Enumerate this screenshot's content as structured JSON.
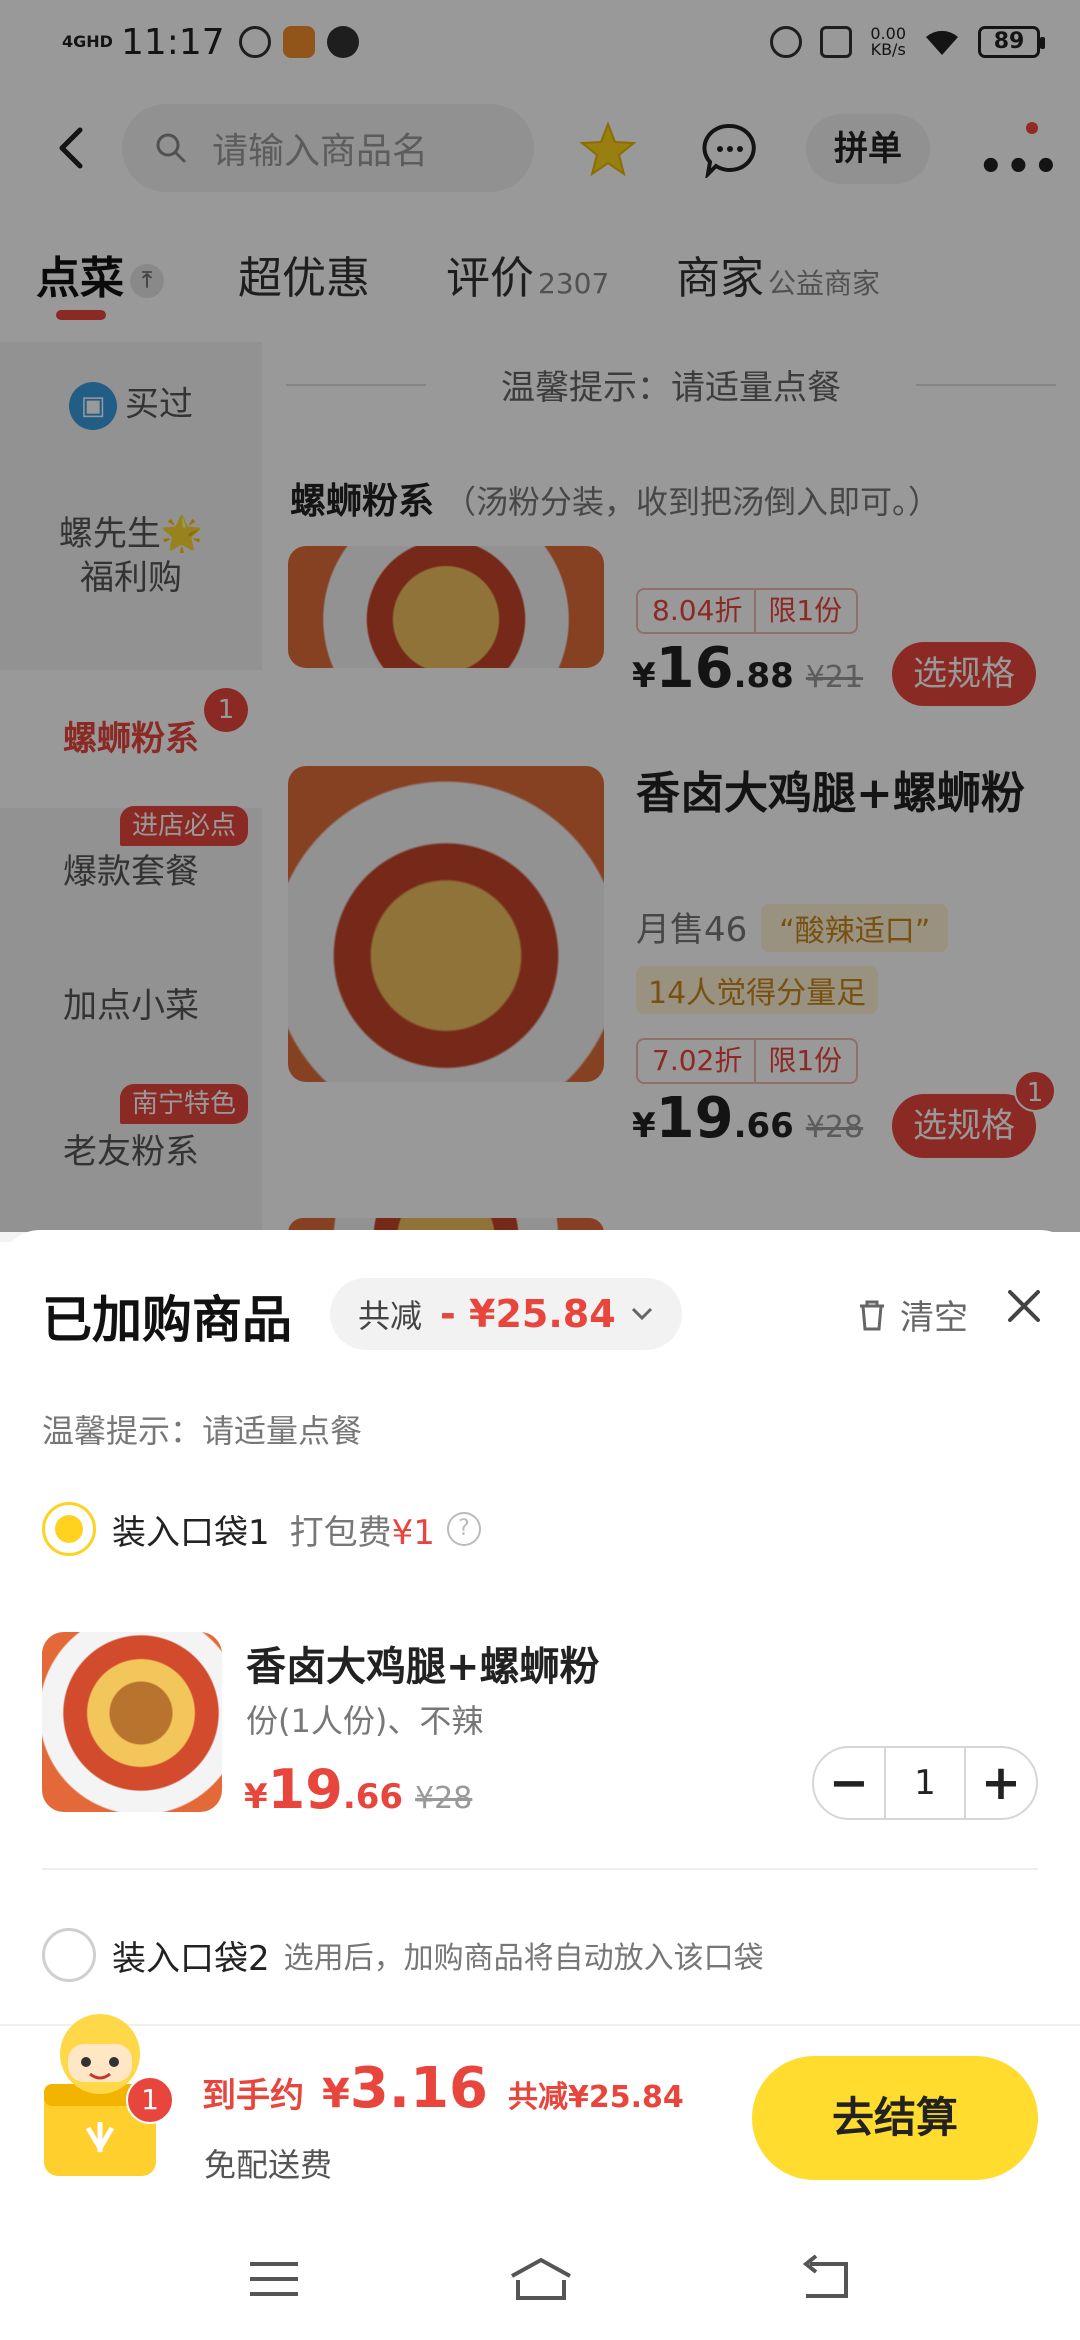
{
  "status_bar": {
    "network": "4GHD",
    "time": "11:17",
    "speed_value": "0.00",
    "speed_unit": "KB/s",
    "battery": "89"
  },
  "header": {
    "search_placeholder": "请输入商品名",
    "group_button": "拼单",
    "more": "•••"
  },
  "tabs": [
    {
      "label": "点菜",
      "active": true
    },
    {
      "label": "超优惠"
    },
    {
      "label": "评价",
      "count": "2307"
    },
    {
      "label": "商家",
      "sub": "公益商家"
    }
  ],
  "sidebar": {
    "items": [
      {
        "label": "买过",
        "icon": "bag-icon"
      },
      {
        "label": "螺先生🌟\n福利购"
      },
      {
        "label": "螺蛳粉系",
        "active": true,
        "badge": "1"
      },
      {
        "label": "爆款套餐",
        "tag": "进店必点"
      },
      {
        "label": "加点小菜"
      },
      {
        "label": "老友粉系",
        "tag": "南宁特色"
      }
    ]
  },
  "content": {
    "tip": "温馨提示：请适量点餐",
    "category_title": "螺蛳粉系",
    "category_note": "（汤粉分装，收到把汤倒入即可。）",
    "dishes": [
      {
        "discount": "8.04折",
        "limit": "限1份",
        "price_int": "16",
        "price_dec": ".88",
        "old_price": "¥21",
        "button": "选规格"
      },
      {
        "name": "香卤大鸡腿+螺蛳粉",
        "sold": "月售46",
        "tag": "“酸辣适口”",
        "feel": "14人觉得分量足",
        "discount": "7.02折",
        "limit": "限1份",
        "price_int": "19",
        "price_dec": ".66",
        "old_price": "¥28",
        "button": "选规格",
        "badge": "1"
      }
    ]
  },
  "sheet": {
    "title": "已加购商品",
    "saving_label": "共减",
    "saving_amount": "- ¥25.84",
    "clear": "清空",
    "tip": "温馨提示：请适量点餐",
    "bag1": {
      "label": "装入口袋1",
      "fee_label": "打包费",
      "fee": "¥1",
      "help": "?"
    },
    "item": {
      "name": "香卤大鸡腿+螺蛳粉",
      "spec": "份(1人份)、不辣",
      "currency": "¥",
      "price_int": "19",
      "price_dec": ".66",
      "old_price": "¥28",
      "qty": "1"
    },
    "bag2": {
      "label": "装入口袋2",
      "hint": "选用后，加购商品将自动放入该口袋"
    }
  },
  "cart": {
    "badge": "1",
    "label": "到手约",
    "currency": "¥",
    "total": "3.16",
    "saving": "共减¥25.84",
    "delivery": "免配送费",
    "checkout": "去结算"
  },
  "colors": {
    "accent_red": "#e8453c",
    "accent_yellow": "#ffdc2d"
  }
}
